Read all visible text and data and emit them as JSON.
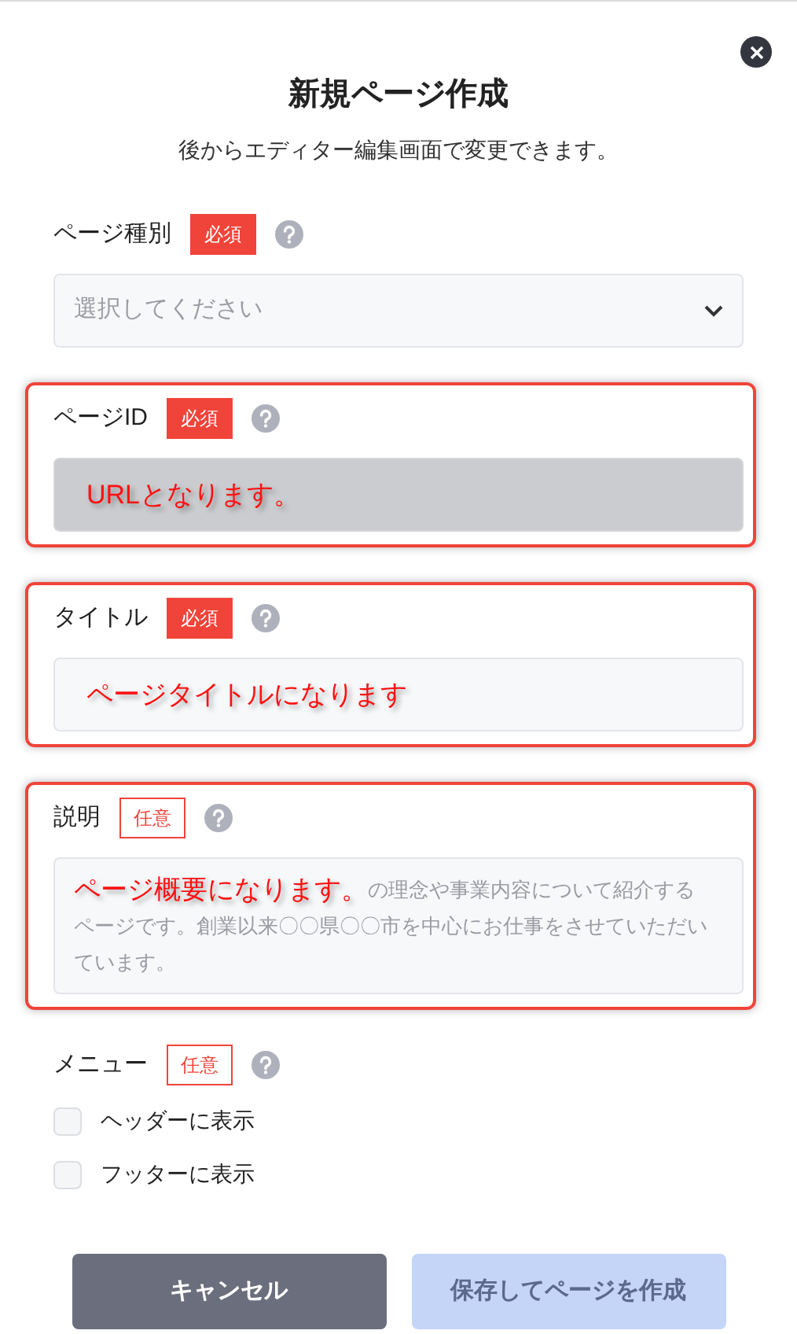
{
  "dialog": {
    "title": "新規ページ作成",
    "subtitle": "後からエディター編集画面で変更できます。"
  },
  "fields": [
    {
      "kind": "select",
      "label": "ページ種別",
      "badge": "必須",
      "required": true,
      "placeholder": "選択してください"
    },
    {
      "kind": "text",
      "label": "ページID",
      "badge": "必須",
      "required": true,
      "disabled": true,
      "note": "URLとなります。"
    },
    {
      "kind": "text",
      "label": "タイトル",
      "badge": "必須",
      "required": true,
      "disabled": false,
      "note": "ページタイトルになります"
    },
    {
      "kind": "textarea",
      "label": "説明",
      "badge": "任意",
      "required": false,
      "note": "ページ概要になります。",
      "placeholder_parts": [
        "の理念や事業内容について紹介する",
        "ページです。創業以来〇〇県〇〇市を中心にお仕事をさせていただいています。"
      ]
    },
    {
      "kind": "checks",
      "label": "メニュー",
      "badge": "任意",
      "required": false,
      "options": [
        {
          "label": "ヘッダーに表示",
          "checked": false
        },
        {
          "label": "フッターに表示",
          "checked": false
        }
      ]
    }
  ],
  "buttons": [
    {
      "label": "キャンセル",
      "kind": "cancel",
      "disabled": false
    },
    {
      "label": "保存してページを作成",
      "kind": "primary",
      "disabled": true
    }
  ]
}
